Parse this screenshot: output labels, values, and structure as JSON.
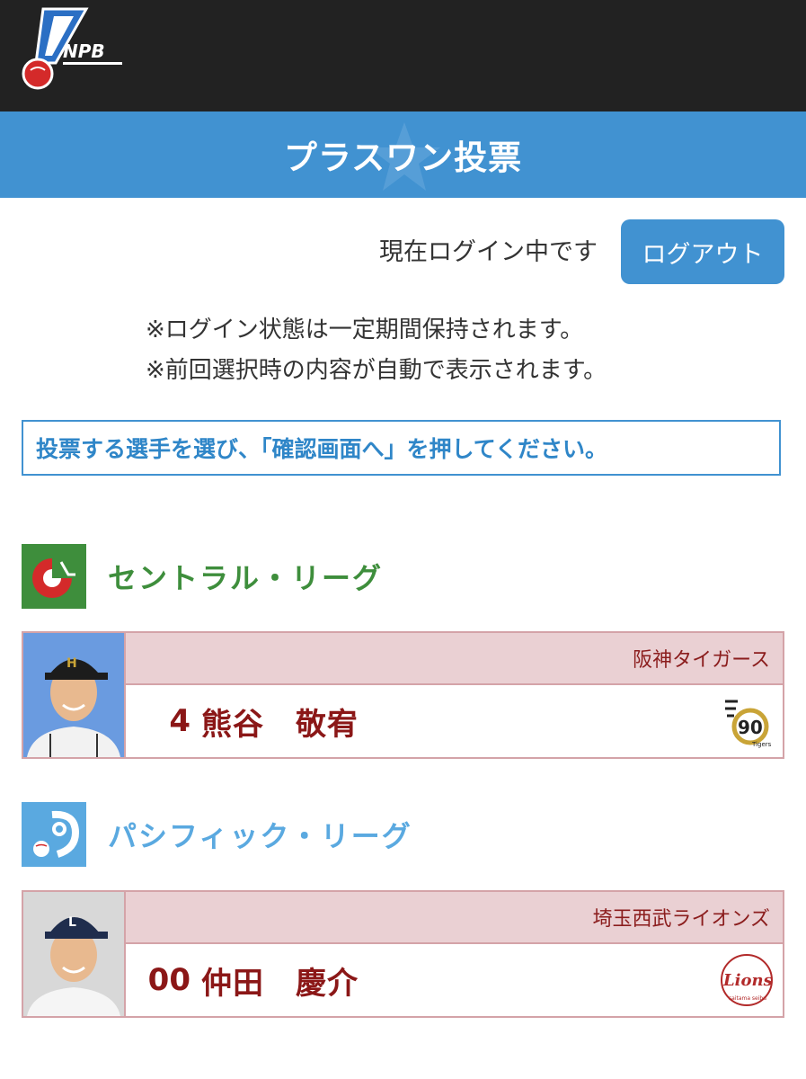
{
  "header": {
    "logo_text": "NPB",
    "title": "プラスワン投票"
  },
  "login": {
    "status": "現在ログイン中です",
    "logout_label": "ログアウト"
  },
  "notes": [
    "※ログイン状態は一定期間保持されます。",
    "※前回選択時の内容が自動で表示されます。"
  ],
  "instruction": "投票する選手を選び、「確認画面へ」を押してください。",
  "leagues": [
    {
      "name": "セントラル・リーグ",
      "color": "#3e8e3c",
      "player": {
        "team": "阪神タイガース",
        "number": "4",
        "name": "熊谷　敬宥"
      }
    },
    {
      "name": "パシフィック・リーグ",
      "color": "#5aa9e0",
      "player": {
        "team": "埼玉西武ライオンズ",
        "number": "00",
        "name": "仲田　慶介"
      }
    }
  ],
  "colors": {
    "header_bg": "#222222",
    "accent_blue": "#4192d1",
    "team_bar_bg": "#ead0d3",
    "player_text": "#8b1717"
  }
}
